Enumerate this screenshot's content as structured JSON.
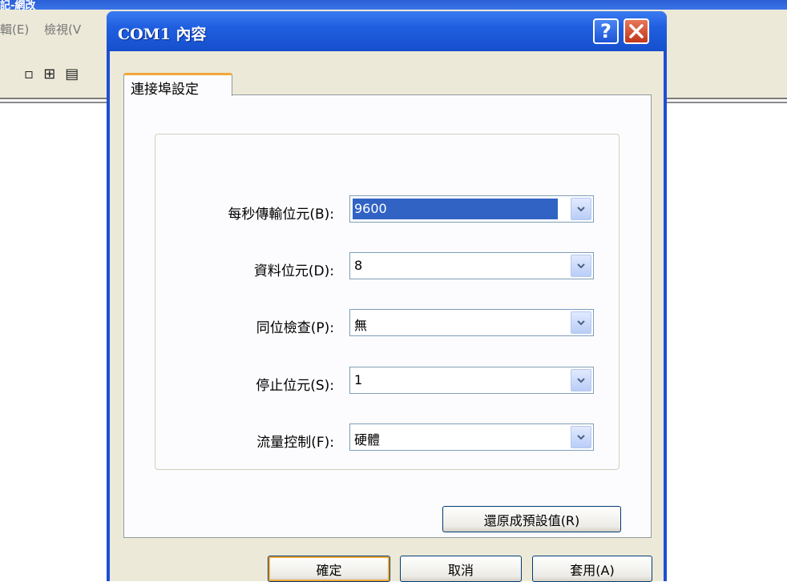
{
  "background_app": {
    "menu": [
      "輯(E)",
      "檢視(V"
    ],
    "title_fragment": "記-網改"
  },
  "dialog": {
    "title": "COM1 內容",
    "help_glyph": "?",
    "tab_label": "連接埠設定",
    "fields": [
      {
        "label": "每秒傳輸位元(B):",
        "value": "9600"
      },
      {
        "label": "資料位元(D):",
        "value": "8"
      },
      {
        "label": "同位檢查(P):",
        "value": "無"
      },
      {
        "label": "停止位元(S):",
        "value": "1"
      },
      {
        "label": "流量控制(F):",
        "value": "硬體"
      }
    ],
    "restore_defaults": "還原成預設值(R)",
    "ok": "確定",
    "cancel": "取消",
    "apply": "套用(A)"
  }
}
